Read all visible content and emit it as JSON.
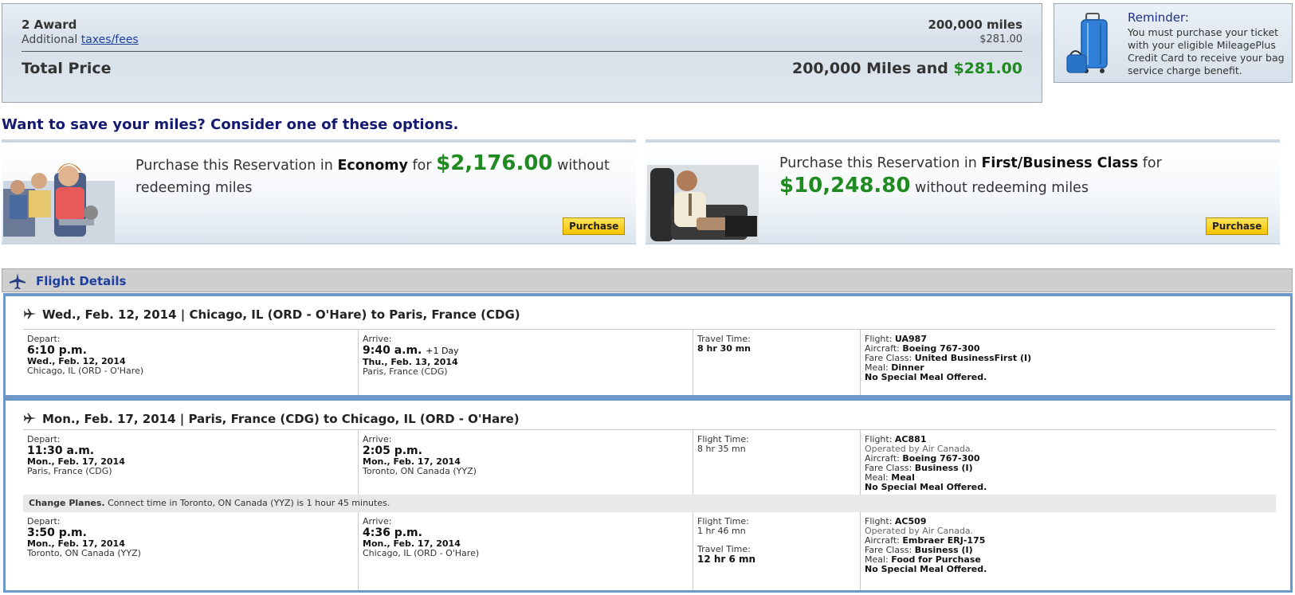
{
  "summary": {
    "award_label": "2 Award",
    "award_miles": "200,000 miles",
    "fees_prefix": "Additional ",
    "fees_link": "taxes/fees",
    "fees_amount": "$281.00",
    "total_label": "Total Price",
    "total_miles": "200,000 Miles and ",
    "total_cash": "$281.00"
  },
  "reminder": {
    "title": "Reminder:",
    "text": "You must purchase your ticket with your eligible MileagePlus Credit Card to receive your bag service charge benefit.",
    "icon": "luggage-icon"
  },
  "save_heading": "Want to save your miles? Consider one of these options.",
  "options": {
    "economy": {
      "prefix": "Purchase this Reservation in ",
      "cabin": "Economy",
      "mid": " for ",
      "price": "$2,176.00",
      "suffix": " without redeeming miles",
      "button": "Purchase"
    },
    "business": {
      "prefix": "Purchase this Reservation in ",
      "cabin": "First/Business Class",
      "mid": " for",
      "price": "$10,248.80",
      "suffix": " without redeeming miles",
      "button": "Purchase"
    }
  },
  "flight_details": {
    "title": "Flight Details",
    "segments": [
      {
        "title": "Wed., Feb. 12, 2014 | Chicago, IL (ORD - O'Hare) to Paris, France (CDG)",
        "legs": [
          {
            "depart_label": "Depart:",
            "depart_time": "6:10 p.m.",
            "depart_date": "Wed., Feb. 12, 2014",
            "depart_city": "Chicago, IL (ORD - O'Hare)",
            "arrive_label": "Arrive:",
            "arrive_time": "9:40 a.m.",
            "arrive_plus": "+1 Day",
            "arrive_date": "Thu., Feb. 13, 2014",
            "arrive_city": "Paris, France (CDG)",
            "time_label": "Travel Time:",
            "time_value": "8 hr 30 mn",
            "flight_label": "Flight:",
            "flight": "UA987",
            "aircraft_label": "Aircraft:",
            "aircraft": "Boeing 767-300",
            "fare_label": "Fare Class:",
            "fare": "United BusinessFirst (I)",
            "meal_label": "Meal:",
            "meal": "Dinner",
            "special": "No Special Meal Offered."
          }
        ]
      },
      {
        "title": "Mon., Feb. 17, 2014 | Paris, France (CDG) to Chicago, IL (ORD - O'Hare)",
        "legs": [
          {
            "depart_label": "Depart:",
            "depart_time": "11:30 a.m.",
            "depart_date": "Mon., Feb. 17, 2014",
            "depart_city": "Paris, France (CDG)",
            "arrive_label": "Arrive:",
            "arrive_time": "2:05 p.m.",
            "arrive_date": "Mon., Feb. 17, 2014",
            "arrive_city": "Toronto, ON Canada (YYZ)",
            "time_label": "Flight Time:",
            "time_value": "8 hr 35 mn",
            "flight_label": "Flight:",
            "flight": "AC881",
            "operated": "Operated by Air Canada.",
            "aircraft_label": "Aircraft:",
            "aircraft": "Boeing 767-300",
            "fare_label": "Fare Class:",
            "fare": "Business (I)",
            "meal_label": "Meal:",
            "meal": "Meal",
            "special": "No Special Meal Offered."
          },
          {
            "depart_label": "Depart:",
            "depart_time": "3:50 p.m.",
            "depart_date": "Mon., Feb. 17, 2014",
            "depart_city": "Toronto, ON Canada (YYZ)",
            "arrive_label": "Arrive:",
            "arrive_time": "4:36 p.m.",
            "arrive_date": "Mon., Feb. 17, 2014",
            "arrive_city": "Chicago, IL (ORD - O'Hare)",
            "time_label": "Flight Time:",
            "time_value": "1 hr 46 mn",
            "travel_label": "Travel Time:",
            "travel_value": "12 hr 6 mn",
            "flight_label": "Flight:",
            "flight": "AC509",
            "operated": "Operated by Air Canada.",
            "aircraft_label": "Aircraft:",
            "aircraft": "Embraer ERJ-175",
            "fare_label": "Fare Class:",
            "fare": "Business (I)",
            "meal_label": "Meal:",
            "meal": "Food for Purchase",
            "special": "No Special Meal Offered."
          }
        ],
        "connection": {
          "label": "Change Planes.",
          "text": " Connect time in Toronto, ON Canada (YYZ) is 1 hour 45 minutes."
        }
      }
    ]
  }
}
